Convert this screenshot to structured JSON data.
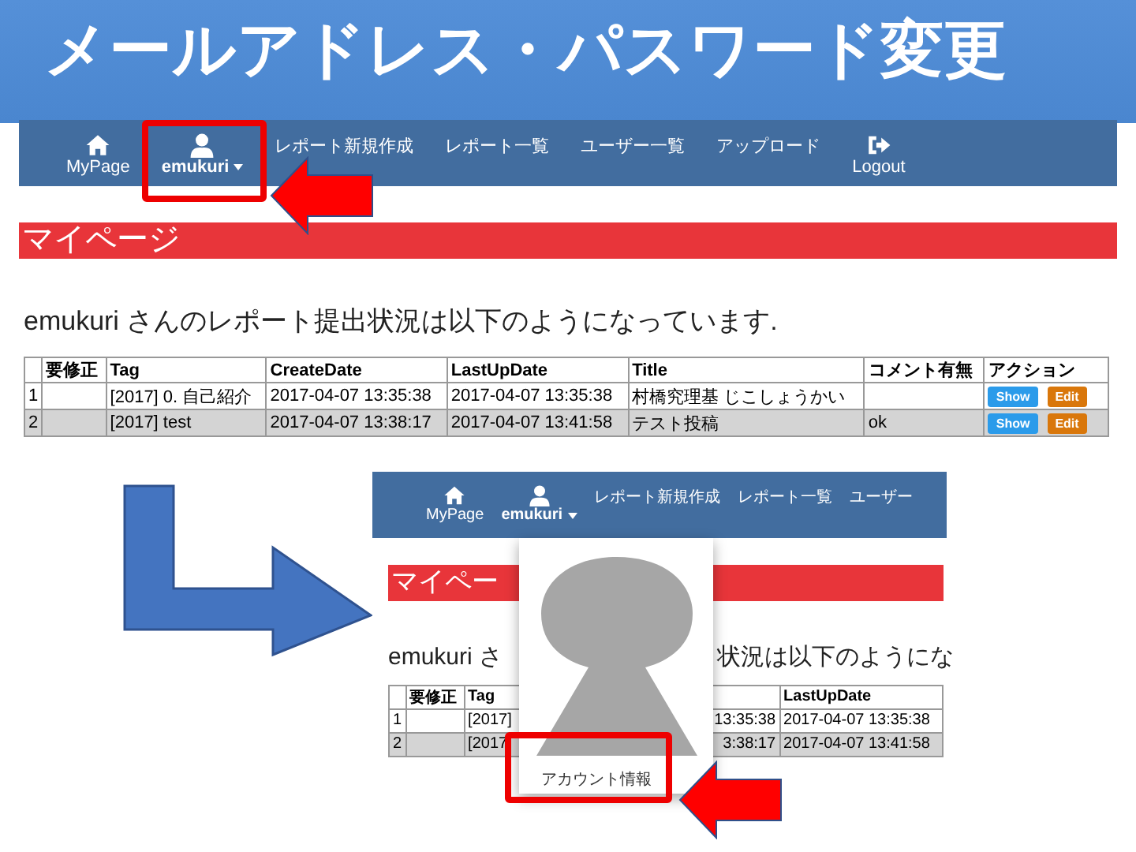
{
  "slide_title": "メールアドレス・パスワード変更",
  "screenshot_1": {
    "nav": [
      {
        "kind": "home",
        "label": "MyPage"
      },
      {
        "kind": "user",
        "label": "emukuri"
      },
      {
        "kind": "text",
        "label": "レポート新規作成"
      },
      {
        "kind": "text",
        "label": "レポート一覧"
      },
      {
        "kind": "text",
        "label": "ユーザー一覧"
      },
      {
        "kind": "text",
        "label": "アップロード"
      },
      {
        "kind": "logout",
        "label": "Logout"
      }
    ],
    "heading": "マイページ",
    "summary": "emukuri さんのレポート提出状況は以下のようになっています.",
    "table": {
      "columns": [
        "要修正",
        "Tag",
        "CreateDate",
        "LastUpDate",
        "Title",
        "コメント有無",
        "アクション"
      ],
      "rows": [
        {
          "no": "1",
          "tag": "[2017] 0. 自己紹介",
          "created": "2017-04-07 13:35:38",
          "updated": "2017-04-07 13:35:38",
          "title": "村橋究理基 じこしょうかい",
          "actions": [
            "Show",
            "Edit"
          ],
          "shaded": false
        },
        {
          "no": "2",
          "tag": "[2017] test",
          "created": "2017-04-07 13:38:17",
          "updated": "2017-04-07 13:41:58",
          "title": "テスト投稿",
          "comment": "ok",
          "actions": [
            "Show",
            "Edit"
          ],
          "shaded": true
        }
      ]
    }
  },
  "screenshot_2": {
    "nav": [
      {
        "kind": "home",
        "label": "MyPage"
      },
      {
        "kind": "user",
        "label": "emukuri"
      },
      {
        "kind": "text",
        "label": "レポート新規作成"
      },
      {
        "kind": "text",
        "label": "レポート一覧"
      },
      {
        "kind": "text",
        "label": "ユーザー"
      }
    ],
    "heading": "マイペー",
    "summary_left": "emukuri さ",
    "summary_right": "状況は以下のようにな",
    "table": {
      "columns": [
        "要修正",
        "Tag",
        "LastUpDate"
      ],
      "rows": [
        {
          "no": "1",
          "tag": "[2017]",
          "created": "13:35:38",
          "updated": "2017-04-07 13:35:38",
          "shaded": false
        },
        {
          "no": "2",
          "tag": "[2017",
          "created": "3:38:17",
          "updated": "2017-04-07 13:41:58",
          "shaded": true
        }
      ]
    },
    "dropdown": {
      "items": [
        "アカウント情報"
      ]
    }
  }
}
